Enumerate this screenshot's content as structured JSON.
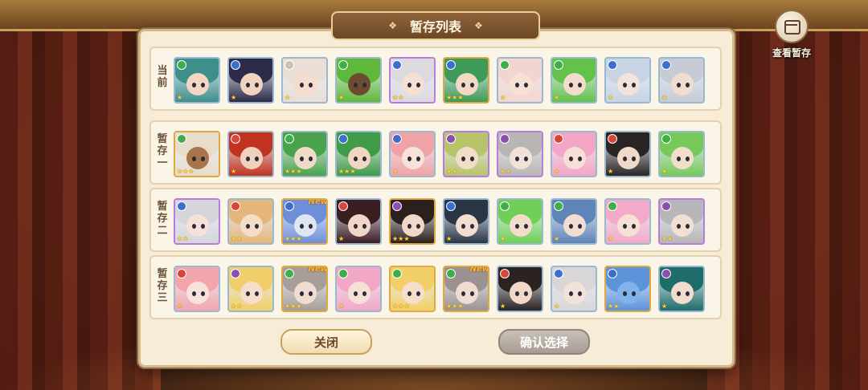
{
  "title": "暂存列表",
  "view_stash_label": "查看暂存",
  "rows": [
    {
      "label": "当前",
      "tiles": [
        {
          "element": "#3fae4a",
          "hair": "#3c8f8a",
          "face": "#f3d7c3",
          "frame": "blue",
          "stars": "★",
          "new": ""
        },
        {
          "element": "#3a6fd0",
          "hair": "#2d2b4a",
          "face": "#f1d3c0",
          "frame": "blue",
          "stars": "★",
          "new": ""
        },
        {
          "element": "#c9c2b8",
          "hair": "#eaded5",
          "face": "#f5dccc",
          "frame": "blue",
          "stars": "★",
          "new": ""
        },
        {
          "element": "#3fae4a",
          "hair": "#5fb83a",
          "face": "#6d4b2e",
          "frame": "blue",
          "stars": "★",
          "new": ""
        },
        {
          "element": "#3a6fd0",
          "hair": "#dcdadf",
          "face": "#f6e0d4",
          "frame": "purple",
          "stars": "★★",
          "new": ""
        },
        {
          "element": "#3a6fd0",
          "hair": "#3e9a58",
          "face": "#f3d8c6",
          "frame": "gold",
          "stars": "★★★",
          "new": ""
        },
        {
          "element": "#3fae4a",
          "hair": "#f3d5cf",
          "face": "#f7e1d6",
          "frame": "blue",
          "stars": "★",
          "new": ""
        },
        {
          "element": "#3fae4a",
          "hair": "#62c24a",
          "face": "#f3dccb",
          "frame": "blue",
          "stars": "★",
          "new": ""
        },
        {
          "element": "#3a6fd0",
          "hair": "#c8d4e3",
          "face": "#f4e2dc",
          "frame": "blue",
          "stars": "★",
          "new": ""
        },
        {
          "element": "#3a6fd0",
          "hair": "#c6cbd6",
          "face": "#f1ddd0",
          "frame": "blue",
          "stars": "★",
          "new": ""
        }
      ]
    },
    {
      "label": "暂存一",
      "tiles": [
        {
          "element": "#3fae4a",
          "hair": "#e8dccb",
          "face": "#a9734c",
          "frame": "gold",
          "stars": "★★★",
          "new": ""
        },
        {
          "element": "#d8453a",
          "hair": "#c1331f",
          "face": "#f1d1bd",
          "frame": "blue",
          "stars": "★",
          "new": ""
        },
        {
          "element": "#3fae4a",
          "hair": "#4aa24c",
          "face": "#f0dbc8",
          "frame": "blue",
          "stars": "★★★",
          "new": ""
        },
        {
          "element": "#3a6fd0",
          "hair": "#3f9b48",
          "face": "#f2d6c2",
          "frame": "blue",
          "stars": "★★★",
          "new": ""
        },
        {
          "element": "#3a6fd0",
          "hair": "#f0a3a6",
          "face": "#f7e2d8",
          "frame": "blue",
          "stars": "★",
          "new": ""
        },
        {
          "element": "#8a4fb0",
          "hair": "#b7c46a",
          "face": "#f2ddc8",
          "frame": "purple",
          "stars": "★★",
          "new": ""
        },
        {
          "element": "#8a4fb0",
          "hair": "#b8b6b5",
          "face": "#f3e0d6",
          "frame": "purple",
          "stars": "★★",
          "new": ""
        },
        {
          "element": "#d8453a",
          "hair": "#f2a5c4",
          "face": "#f6dfd5",
          "frame": "blue",
          "stars": "★",
          "new": ""
        },
        {
          "element": "#d8453a",
          "hair": "#2a2424",
          "face": "#f1d9c9",
          "frame": "blue",
          "stars": "★",
          "new": ""
        },
        {
          "element": "#3fae4a",
          "hair": "#77c95a",
          "face": "#f3ddcb",
          "frame": "blue",
          "stars": "★",
          "new": ""
        }
      ]
    },
    {
      "label": "暂存二",
      "tiles": [
        {
          "element": "#3a6fd0",
          "hair": "#d6d5dc",
          "face": "#f6e1d8",
          "frame": "purple",
          "stars": "★★",
          "new": ""
        },
        {
          "element": "#d8453a",
          "hair": "#e4b67a",
          "face": "#f4dcc9",
          "frame": "blue",
          "stars": "★★",
          "new": ""
        },
        {
          "element": "#3a6fd0",
          "hair": "#6e8fd8",
          "face": "#dfe6f2",
          "frame": "gold",
          "stars": "★★★",
          "new": "New"
        },
        {
          "element": "#d8453a",
          "hair": "#3a1e22",
          "face": "#f2d6c8",
          "frame": "blue",
          "stars": "★",
          "new": ""
        },
        {
          "element": "#8a4fb0",
          "hair": "#2b201c",
          "face": "#f1d7c6",
          "frame": "gold",
          "stars": "★★★",
          "new": ""
        },
        {
          "element": "#3a6fd0",
          "hair": "#2a3646",
          "face": "#f3ddd1",
          "frame": "blue",
          "stars": "★",
          "new": ""
        },
        {
          "element": "#3fae4a",
          "hair": "#6fcf57",
          "face": "#f3dccb",
          "frame": "blue",
          "stars": "★",
          "new": ""
        },
        {
          "element": "#3fae4a",
          "hair": "#5e84b8",
          "face": "#f2ddd2",
          "frame": "blue",
          "stars": "★",
          "new": ""
        },
        {
          "element": "#3fae4a",
          "hair": "#f3a9c8",
          "face": "#f6e0d6",
          "frame": "blue",
          "stars": "★",
          "new": ""
        },
        {
          "element": "#8a4fb0",
          "hair": "#b7b6b8",
          "face": "#f1dfd4",
          "frame": "purple",
          "stars": "★★",
          "new": ""
        }
      ]
    },
    {
      "label": "暂存三",
      "tiles": [
        {
          "element": "#d8453a",
          "hair": "#f3a5ad",
          "face": "#f8e3da",
          "frame": "blue",
          "stars": "★",
          "new": ""
        },
        {
          "element": "#8a4fb0",
          "hair": "#f0cf6a",
          "face": "#f5dfca",
          "frame": "blue",
          "stars": "★★",
          "new": ""
        },
        {
          "element": "#3fae4a",
          "hair": "#a79e99",
          "face": "#f1dcd0",
          "frame": "gold",
          "stars": "★★★",
          "new": "New"
        },
        {
          "element": "#3fae4a",
          "hair": "#f2a7c7",
          "face": "#f6e0d6",
          "frame": "blue",
          "stars": "★",
          "new": ""
        },
        {
          "element": "#3fae4a",
          "hair": "#f1cf68",
          "face": "#f5dfca",
          "frame": "gold",
          "stars": "★★★",
          "new": ""
        },
        {
          "element": "#3fae4a",
          "hair": "#9b9391",
          "face": "#f1dcd1",
          "frame": "gold",
          "stars": "★★★",
          "new": "New"
        },
        {
          "element": "#d8453a",
          "hair": "#2b2322",
          "face": "#f1d8c8",
          "frame": "blue",
          "stars": "★",
          "new": ""
        },
        {
          "element": "#3a6fd0",
          "hair": "#d9d6d7",
          "face": "#f3e2d9",
          "frame": "blue",
          "stars": "★",
          "new": ""
        },
        {
          "element": "#3a6fd0",
          "hair": "#5d93d9",
          "face": "#7fb3ea",
          "frame": "gold",
          "stars": "★★",
          "new": ""
        },
        {
          "element": "#8a4fb0",
          "hair": "#1f6d6a",
          "face": "#f2dcd0",
          "frame": "blue",
          "stars": "★",
          "new": ""
        }
      ]
    }
  ],
  "buttons": {
    "close": "关闭",
    "confirm": "确认选择"
  }
}
